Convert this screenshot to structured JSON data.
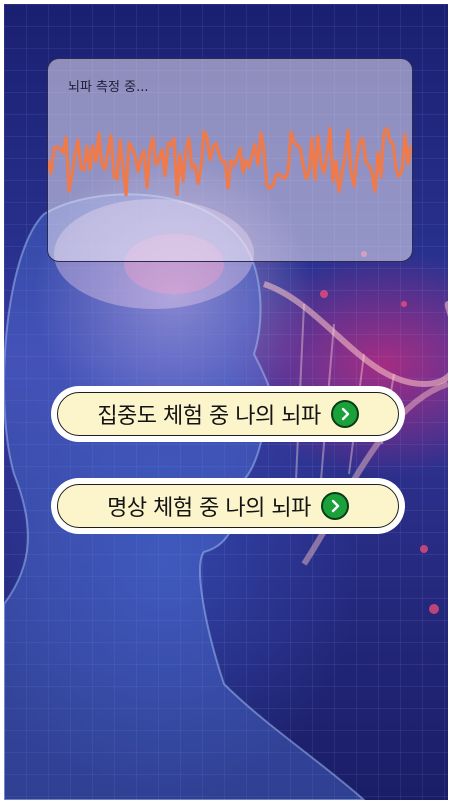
{
  "wave_card": {
    "title": "뇌파 측정 중...",
    "wave_color": "#ef7a4a"
  },
  "buttons": [
    {
      "label": "집중도 체험 중 나의 뇌파",
      "icon": "chevron-right-icon"
    },
    {
      "label": "명상 체험 중 나의 뇌파",
      "icon": "chevron-right-icon"
    }
  ],
  "colors": {
    "button_fill": "#fcf5cc",
    "arrow_green": "#1aa13a",
    "background": "#27308c"
  }
}
